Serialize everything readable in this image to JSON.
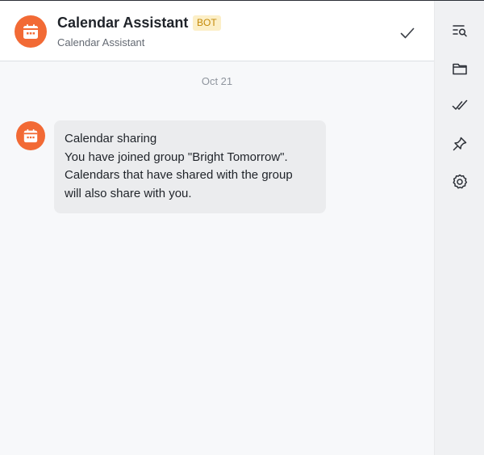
{
  "header": {
    "title": "Calendar Assistant",
    "badge": "BOT",
    "subtitle": "Calendar Assistant"
  },
  "chat": {
    "date_divider": "Oct 21",
    "message": {
      "heading": "Calendar sharing",
      "line2": "You have joined group \"Bright Tomorrow\".",
      "line3": "Calendars that have shared with the group",
      "line4": "will also share with you."
    }
  },
  "sidebar": {
    "items": [
      {
        "icon": "search-history-icon"
      },
      {
        "icon": "folder-icon"
      },
      {
        "icon": "double-check-icon"
      },
      {
        "icon": "pin-icon"
      },
      {
        "icon": "settings-gear-icon"
      }
    ]
  },
  "colors": {
    "accent": "#f26a35",
    "badge_bg": "#fcefc7",
    "badge_text": "#c48a0a",
    "bubble": "#ebecee"
  }
}
